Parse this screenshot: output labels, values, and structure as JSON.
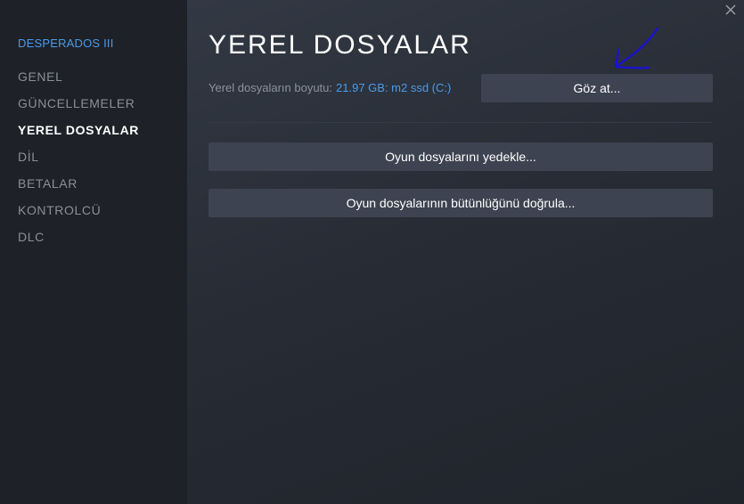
{
  "sidebar": {
    "game_title": "DESPERADOS III",
    "items": [
      {
        "label": "GENEL",
        "active": false
      },
      {
        "label": "GÜNCELLEMELER",
        "active": false
      },
      {
        "label": "YEREL DOSYALAR",
        "active": true
      },
      {
        "label": "DİL",
        "active": false
      },
      {
        "label": "BETALAR",
        "active": false
      },
      {
        "label": "KONTROLCÜ",
        "active": false
      },
      {
        "label": "DLC",
        "active": false
      }
    ]
  },
  "window": {
    "close_icon": "close-icon"
  },
  "main": {
    "title": "YEREL DOSYALAR",
    "size_label": "Yerel dosyaların boyutu:",
    "size_value": "21.97 GB: m2 ssd (C:)",
    "browse_button": "Göz at...",
    "backup_button": "Oyun dosyalarını yedekle...",
    "verify_button": "Oyun dosyalarının bütünlüğünü doğrula..."
  },
  "colors": {
    "accent": "#4a9bea",
    "sidebar_bg": "#1e2127",
    "button_bg": "#3d4350",
    "annotation": "#1a10d8"
  }
}
